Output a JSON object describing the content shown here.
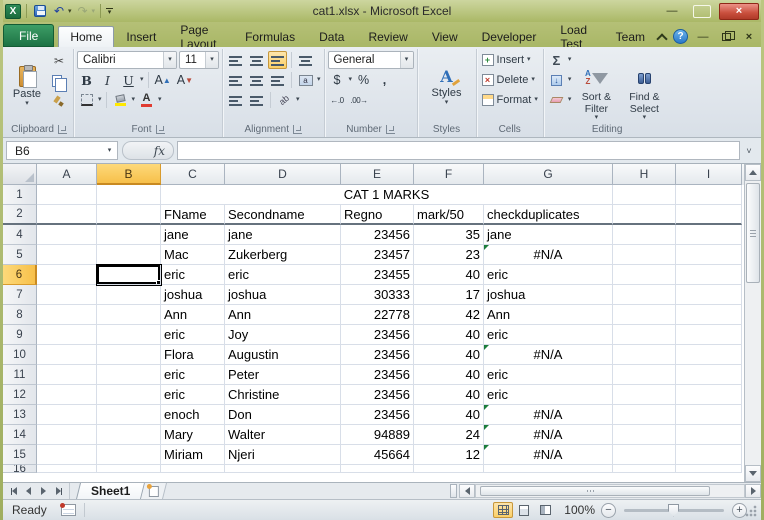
{
  "window": {
    "title": "cat1.xlsx - Microsoft Excel"
  },
  "icons": {
    "app": "X",
    "dropdown": "▾",
    "scissors": "✂",
    "undo": "↶",
    "redo": "↷",
    "minimize": "—",
    "close": "×",
    "help": "?",
    "chevron_down": "˅",
    "sum": "Σ",
    "fill_down": "↓",
    "bold": "B",
    "italic": "I",
    "underline": "U",
    "grow_font": "A",
    "shrink_font": "A",
    "font_color": "A",
    "orientation": "ab",
    "merge_letter": "a",
    "currency": "$",
    "percent": "%",
    "comma": ",",
    "inc_decimal": "←.0",
    "dec_decimal": ".00→",
    "fx": "fx",
    "az_a": "A",
    "az_z": "Z",
    "minus": "−",
    "plus": "+"
  },
  "ribbon_tabs": {
    "active": "Home",
    "items": [
      "File",
      "Home",
      "Insert",
      "Page Layout",
      "Formulas",
      "Data",
      "Review",
      "View",
      "Developer",
      "Load Test",
      "Team"
    ]
  },
  "ribbon": {
    "clipboard": {
      "paste": "Paste",
      "label": "Clipboard"
    },
    "font": {
      "name": "Calibri",
      "size": "11",
      "label": "Font"
    },
    "alignment": {
      "label": "Alignment"
    },
    "number": {
      "format": "General",
      "label": "Number"
    },
    "styles": {
      "button": "Styles",
      "label": "Styles"
    },
    "cells": {
      "insert": "Insert",
      "delete": "Delete",
      "format": "Format",
      "label": "Cells"
    },
    "editing": {
      "sort_filter": "Sort & Filter",
      "find_select": "Find & Select",
      "label": "Editing"
    }
  },
  "formula_bar": {
    "name_box": "B6",
    "value": ""
  },
  "grid": {
    "columns": [
      "A",
      "B",
      "C",
      "D",
      "E",
      "F",
      "G",
      "H",
      "I"
    ],
    "selected_column": "B",
    "selected_row": "6",
    "active_cell": "B6",
    "rows": [
      {
        "n": "1",
        "merge": {
          "from": "C",
          "to": "G",
          "text": "CAT 1 MARKS"
        }
      },
      {
        "n": "2",
        "cells": {
          "C": "FName",
          "D": "Secondname",
          "E": "Regno",
          "F": "mark/50",
          "G": "checkduplicates"
        },
        "thick_bottom": true
      },
      {
        "n": "4",
        "cells": {
          "C": "jane",
          "D": "jane",
          "E": "23456",
          "F": "35",
          "G": "jane"
        }
      },
      {
        "n": "5",
        "cells": {
          "C": "Mac",
          "D": "Zukerberg",
          "E": "23457",
          "F": "23",
          "G": "#N/A"
        },
        "flags": [
          "G"
        ]
      },
      {
        "n": "6",
        "cells": {
          "C": "eric",
          "D": "eric",
          "E": "23455",
          "F": "40",
          "G": "eric"
        }
      },
      {
        "n": "7",
        "cells": {
          "C": "joshua",
          "D": "joshua",
          "E": "30333",
          "F": "17",
          "G": "joshua"
        }
      },
      {
        "n": "8",
        "cells": {
          "C": "Ann",
          "D": "Ann",
          "E": "22778",
          "F": "42",
          "G": "Ann"
        }
      },
      {
        "n": "9",
        "cells": {
          "C": "eric",
          "D": "Joy",
          "E": "23456",
          "F": "40",
          "G": "eric"
        }
      },
      {
        "n": "10",
        "cells": {
          "C": "Flora",
          "D": "Augustin",
          "E": "23456",
          "F": "40",
          "G": "#N/A"
        },
        "flags": [
          "G"
        ]
      },
      {
        "n": "11",
        "cells": {
          "C": "eric",
          "D": "Peter",
          "E": "23456",
          "F": "40",
          "G": "eric"
        }
      },
      {
        "n": "12",
        "cells": {
          "C": "eric",
          "D": "Christine",
          "E": "23456",
          "F": "40",
          "G": "eric"
        }
      },
      {
        "n": "13",
        "cells": {
          "C": "enoch",
          "D": "Don",
          "E": "23456",
          "F": "40",
          "G": "#N/A"
        },
        "flags": [
          "G"
        ]
      },
      {
        "n": "14",
        "cells": {
          "C": "Mary",
          "D": "Walter",
          "E": "94889",
          "F": "24",
          "G": "#N/A"
        },
        "flags": [
          "G"
        ]
      },
      {
        "n": "15",
        "cells": {
          "C": "Miriam",
          "D": "Njeri",
          "E": "45664",
          "F": "12",
          "G": "#N/A"
        },
        "flags": [
          "G"
        ]
      },
      {
        "n": "16",
        "cells": {},
        "partial": true
      }
    ]
  },
  "sheet_bar": {
    "active_tab": "Sheet1"
  },
  "status_bar": {
    "mode": "Ready",
    "zoom": "100%"
  }
}
